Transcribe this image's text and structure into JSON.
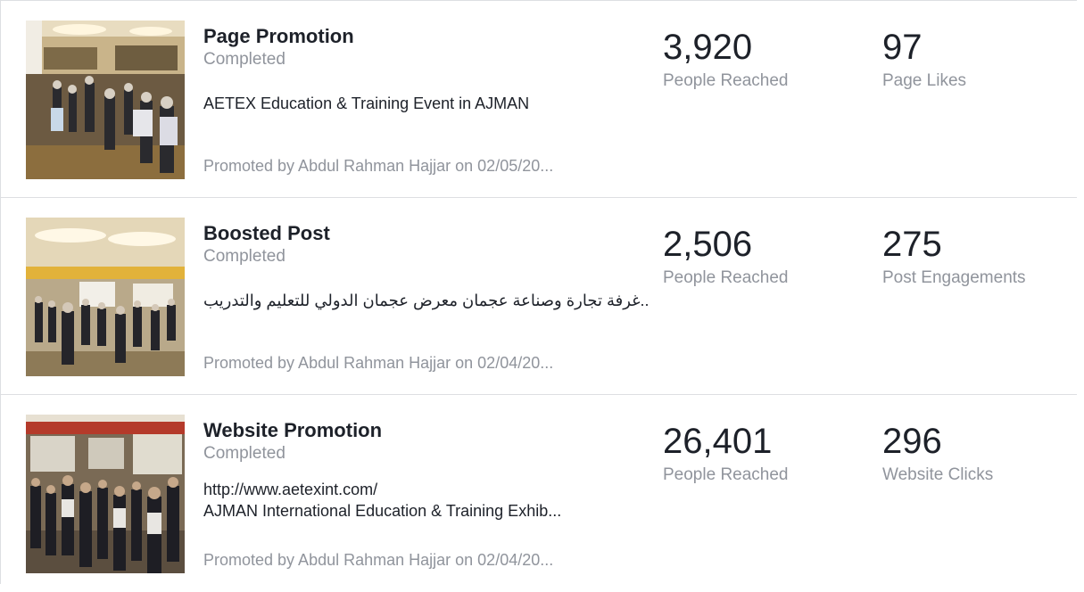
{
  "promotions": [
    {
      "title": "Page Promotion",
      "status": "Completed",
      "description": "AETEX Education & Training Event in AJMAN",
      "description_line2": "",
      "promoted_by": "Promoted by Abdul Rahman Hajjar on 02/05/20...",
      "metric1": {
        "value": "3,920",
        "label": "People Reached"
      },
      "metric2": {
        "value": "97",
        "label": "Page Likes"
      }
    },
    {
      "title": "Boosted Post",
      "status": "Completed",
      "description": "..غرفة تجارة وصناعة عجمان معرض عجمان الدولي للتعليم والتدريب",
      "description_line2": "",
      "promoted_by": "Promoted by Abdul Rahman Hajjar on 02/04/20...",
      "metric1": {
        "value": "2,506",
        "label": "People Reached"
      },
      "metric2": {
        "value": "275",
        "label": "Post Engagements"
      }
    },
    {
      "title": "Website Promotion",
      "status": "Completed",
      "description": "http://www.aetexint.com/",
      "description_line2": "AJMAN International Education & Training Exhib...",
      "promoted_by": "Promoted by Abdul Rahman Hajjar on 02/04/20...",
      "metric1": {
        "value": "26,401",
        "label": "People Reached"
      },
      "metric2": {
        "value": "296",
        "label": "Website Clicks"
      }
    }
  ],
  "colors": {
    "primary_text": "#1d2129",
    "secondary_text": "#90949c",
    "divider": "#dddfe2"
  }
}
